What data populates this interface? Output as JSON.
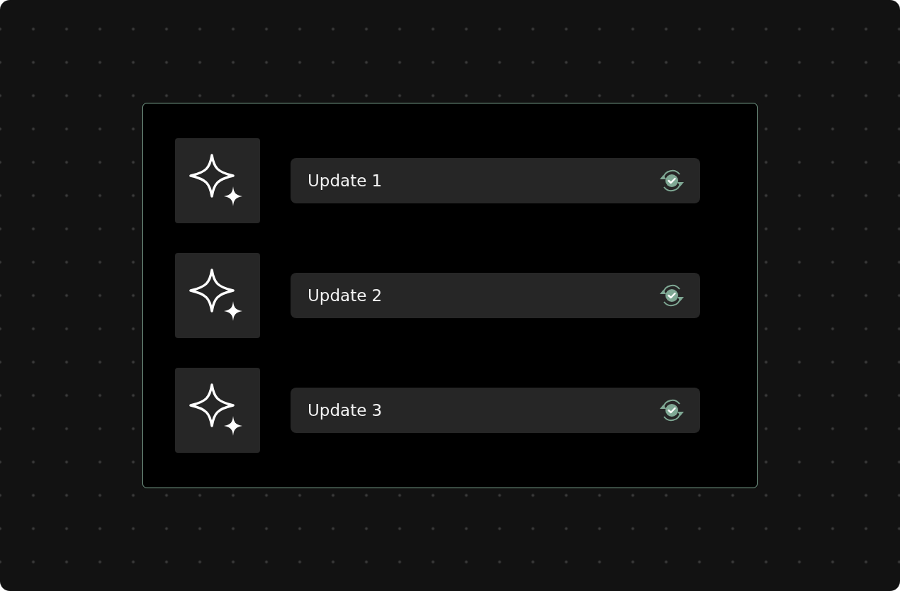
{
  "updates": [
    {
      "label": "Update 1"
    },
    {
      "label": "Update 2"
    },
    {
      "label": "Update 3"
    }
  ]
}
